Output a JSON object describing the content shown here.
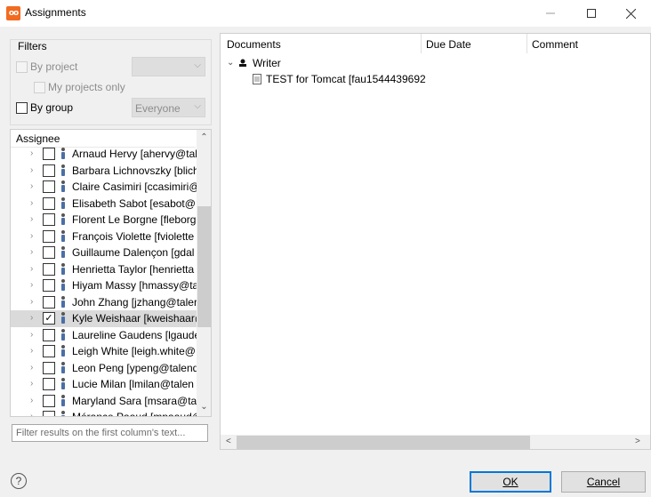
{
  "window": {
    "app_icon": "talend-logo-icon",
    "title": "Assignments",
    "min_icon": "—",
    "max_icon": "☐",
    "close_icon": "✕"
  },
  "filters": {
    "group_label": "Filters",
    "by_project_label": "By project",
    "my_projects_only_label": "My projects only",
    "by_group_label": "By group",
    "project_combo_value": "",
    "group_combo_value": "Everyone"
  },
  "assignee": {
    "header": "Assignee",
    "rows": [
      {
        "text": "Arnaud Hervy [ahervy@tal",
        "checked": false
      },
      {
        "text": "Barbara Lichnovszky [blich",
        "checked": false
      },
      {
        "text": "Claire Casimiri [ccasimiri@",
        "checked": false
      },
      {
        "text": "Elisabeth Sabot [esabot@",
        "checked": false
      },
      {
        "text": "Florent Le Borgne [fleborg",
        "checked": false
      },
      {
        "text": "François Violette [fviolette",
        "checked": false
      },
      {
        "text": "Guillaume Dalençon [gdal",
        "checked": false
      },
      {
        "text": "Henrietta Taylor [henrietta",
        "checked": false
      },
      {
        "text": "Hiyam Massy [hmassy@tal",
        "checked": false
      },
      {
        "text": "John Zhang [jzhang@taler",
        "checked": false
      },
      {
        "text": "Kyle Weishaar [kweishaar@",
        "checked": true
      },
      {
        "text": "Laureline Gaudens [lgaude",
        "checked": false
      },
      {
        "text": "Leigh White [leigh.white@",
        "checked": false
      },
      {
        "text": "Leon Peng [ypeng@talend",
        "checked": false
      },
      {
        "text": "Lucie Milan [lmilan@talen",
        "checked": false
      },
      {
        "text": "Maryland Sara [msara@tal",
        "checked": false
      },
      {
        "text": "Mérance Paaud [mpaaud@",
        "checked": false
      }
    ],
    "filter_placeholder": "Filter results on the first column's text..."
  },
  "documents": {
    "columns": [
      "Documents",
      "Due Date",
      "Comment"
    ],
    "root_label": "Writer",
    "child_label": "TEST for Tomcat [fau1544439692"
  },
  "buttons": {
    "help": "?",
    "ok_label": "OK",
    "cancel_label": "Cancel"
  }
}
